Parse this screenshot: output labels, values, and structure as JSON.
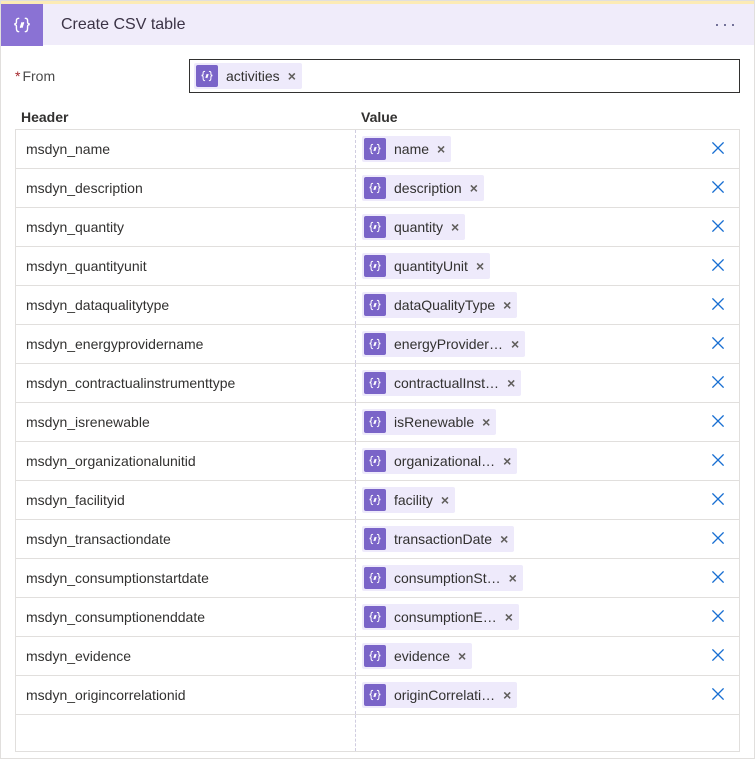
{
  "header": {
    "title": "Create CSV table"
  },
  "from": {
    "label": "From",
    "token": "activities"
  },
  "columns": {
    "headerLabel": "Header",
    "valueLabel": "Value"
  },
  "rows": [
    {
      "header": "msdyn_name",
      "value": "name"
    },
    {
      "header": "msdyn_description",
      "value": "description"
    },
    {
      "header": "msdyn_quantity",
      "value": "quantity"
    },
    {
      "header": "msdyn_quantityunit",
      "value": "quantityUnit"
    },
    {
      "header": "msdyn_dataqualitytype",
      "value": "dataQualityType"
    },
    {
      "header": "msdyn_energyprovidername",
      "value": "energyProvider…"
    },
    {
      "header": "msdyn_contractualinstrumenttype",
      "value": "contractualInst…"
    },
    {
      "header": "msdyn_isrenewable",
      "value": "isRenewable"
    },
    {
      "header": "msdyn_organizationalunitid",
      "value": "organizational…"
    },
    {
      "header": "msdyn_facilityid",
      "value": "facility"
    },
    {
      "header": "msdyn_transactiondate",
      "value": "transactionDate"
    },
    {
      "header": "msdyn_consumptionstartdate",
      "value": "consumptionSt…"
    },
    {
      "header": "msdyn_consumptionenddate",
      "value": "consumptionE…"
    },
    {
      "header": "msdyn_evidence",
      "value": "evidence"
    },
    {
      "header": "msdyn_origincorrelationid",
      "value": "originCorrelati…"
    }
  ]
}
